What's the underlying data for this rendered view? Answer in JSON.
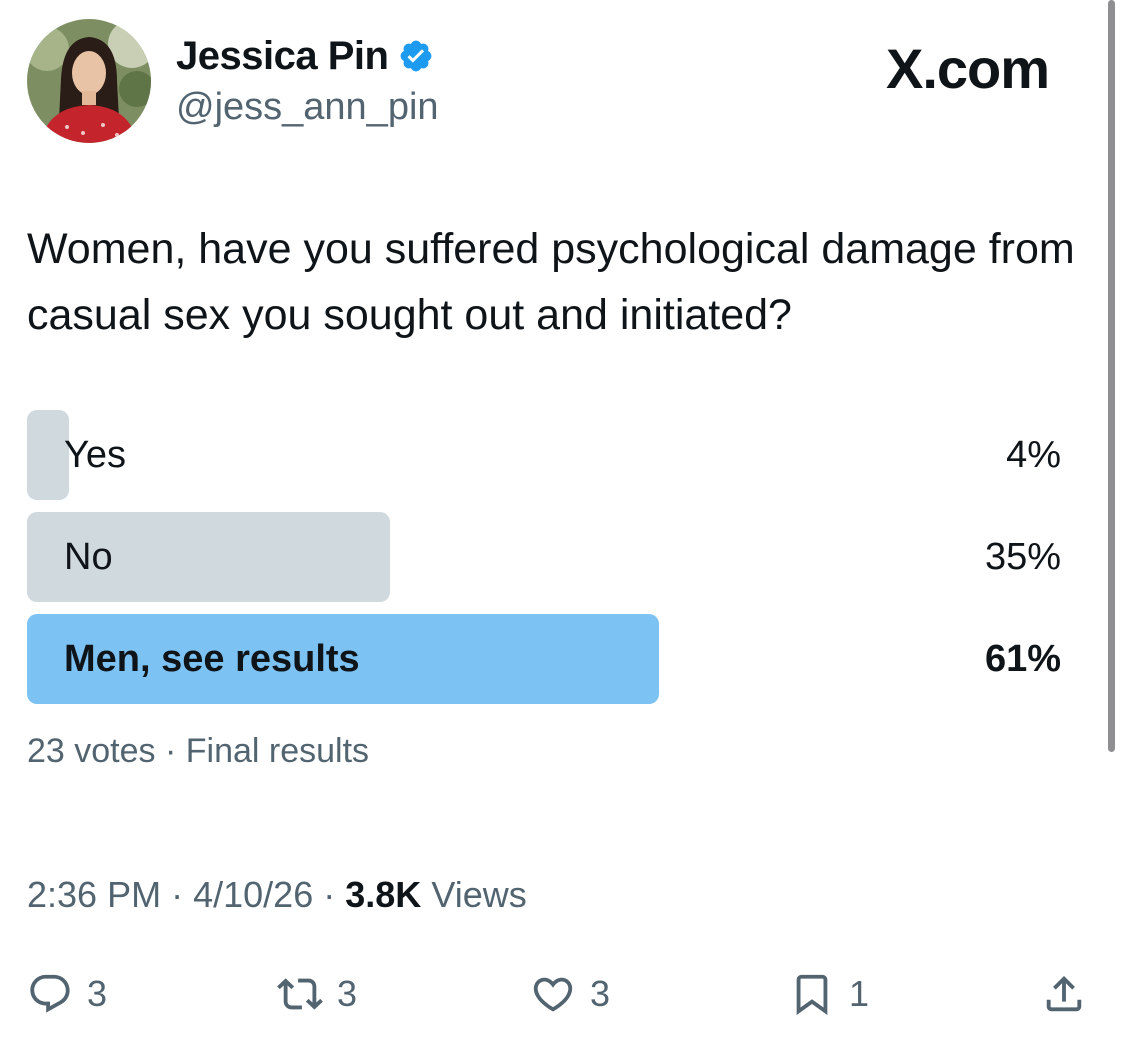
{
  "author": {
    "display_name": "Jessica Pin",
    "handle": "@jess_ann_pin",
    "verified": true
  },
  "brand": "X.com",
  "tweet": {
    "text": "Women, have you suffered psychological damage from casual sex you sought out and initiated?"
  },
  "poll": {
    "options": [
      {
        "label": "Yes",
        "percent_text": "4%",
        "percent": 4,
        "winner": false
      },
      {
        "label": "No",
        "percent_text": "35%",
        "percent": 35,
        "winner": false
      },
      {
        "label": "Men, see results",
        "percent_text": "61%",
        "percent": 61,
        "winner": true
      }
    ],
    "votes": "23 votes",
    "separator": "·",
    "status": "Final results"
  },
  "meta": {
    "time": "2:36 PM",
    "date": "4/10/26",
    "separator": "·",
    "views_count": "3.8K",
    "views_label": "Views"
  },
  "actions": {
    "replies": "3",
    "reposts": "3",
    "likes": "3",
    "bookmarks": "1"
  },
  "colors": {
    "text": "#0f1419",
    "secondary": "#536471",
    "poll_bar": "#cfd9de",
    "poll_winner": "#7cc3f4",
    "verified": "#1d9bf0"
  }
}
